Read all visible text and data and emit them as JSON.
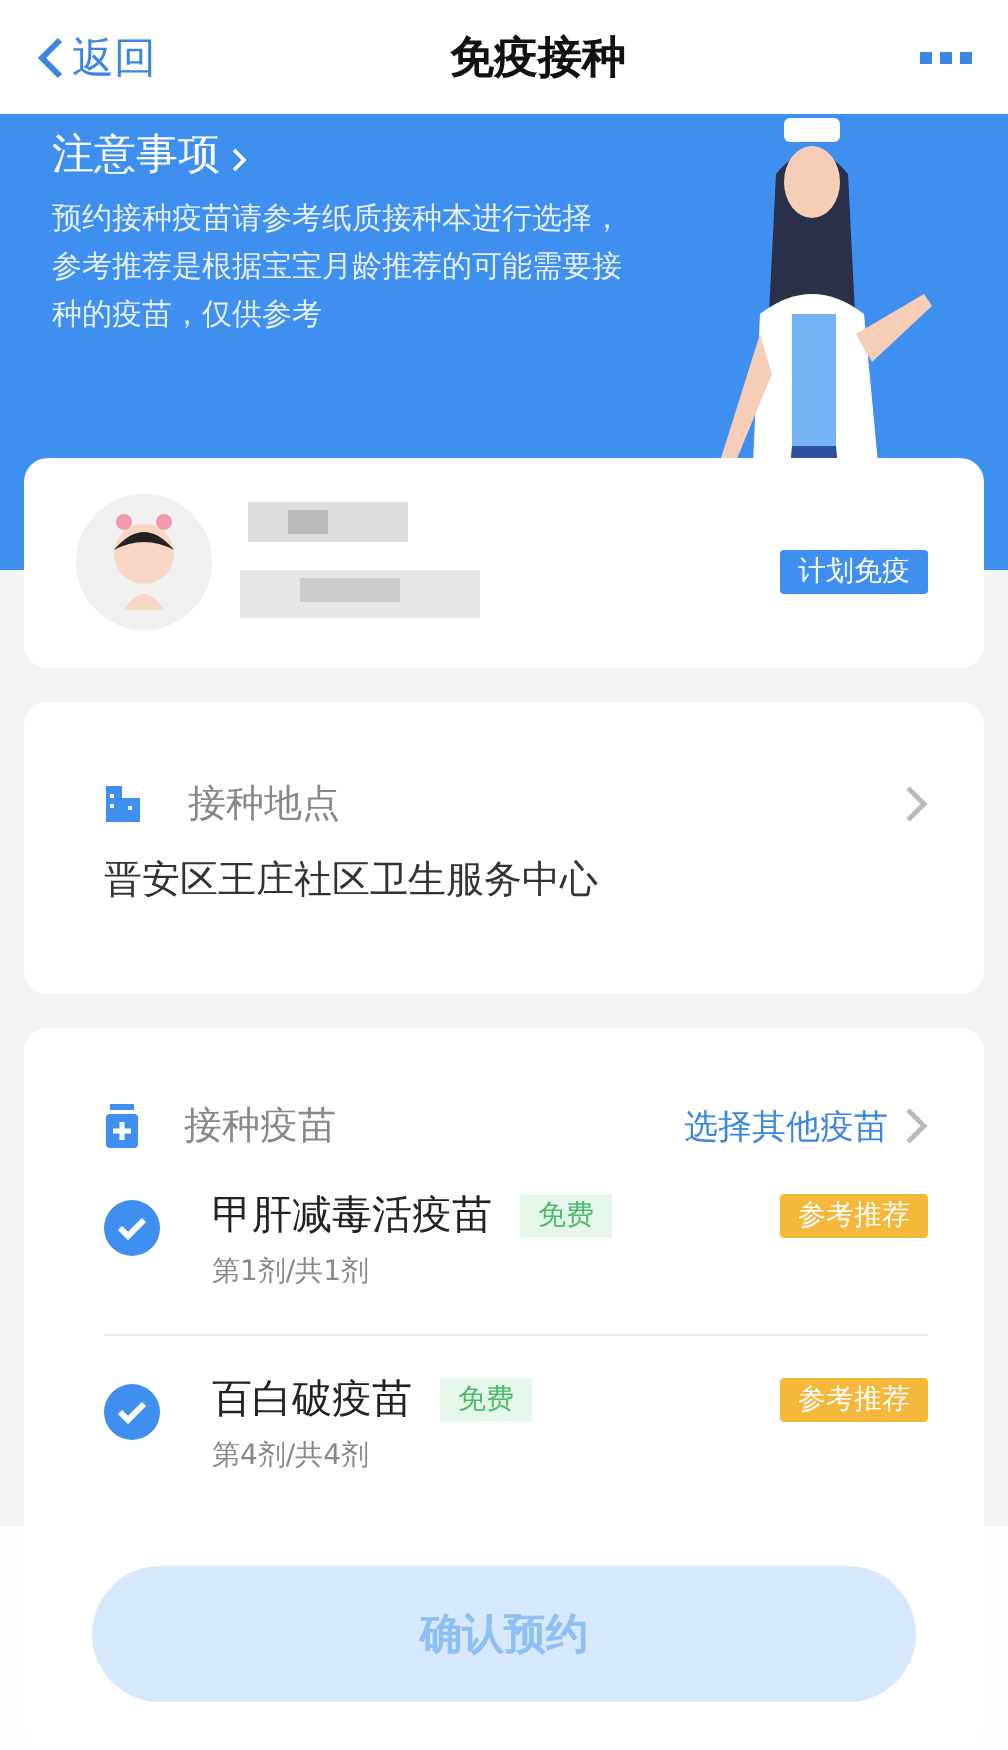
{
  "nav": {
    "back": "返回",
    "title": "免疫接种"
  },
  "notice": {
    "title": "注意事项",
    "text": "预约接种疫苗请参考纸质接种本进行选择，参考推荐是根据宝宝月龄推荐的可能需要接种的疫苗，仅供参考"
  },
  "child": {
    "plan_tag": "计划免疫"
  },
  "location": {
    "label": "接种地点",
    "value": "晋安区王庄社区卫生服务中心"
  },
  "vaccines": {
    "label": "接种疫苗",
    "other_link": "选择其他疫苗",
    "items": [
      {
        "name": "甲肝减毒活疫苗",
        "price_tag": "免费",
        "recommend_tag": "参考推荐",
        "dose": "第1剂/共1剂",
        "checked": true
      },
      {
        "name": "百白破疫苗",
        "price_tag": "免费",
        "recommend_tag": "参考推荐",
        "dose": "第4剂/共4剂",
        "checked": true
      }
    ]
  },
  "confirm_button": {
    "label": "确认预约",
    "disabled": true
  }
}
